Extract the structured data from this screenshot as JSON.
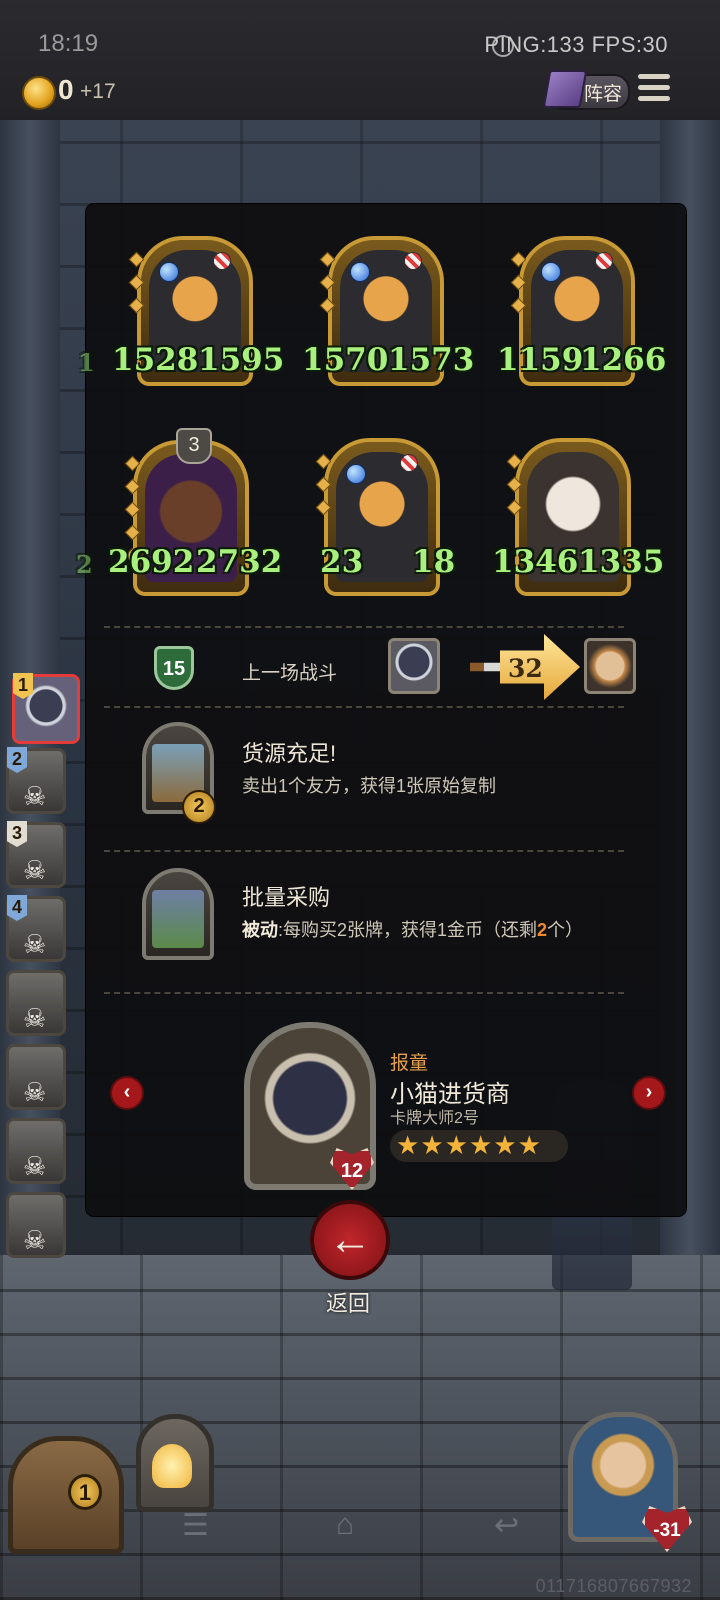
{
  "status_bar": {
    "time": "18:19",
    "ping_fps": "PING:133  FPS:30"
  },
  "top_bar": {
    "gold": "0",
    "gold_income": "+17",
    "lineup_label": "阵容"
  },
  "board": {
    "cards": [
      {
        "attack": "1528",
        "health": "1595",
        "art": "raccoon"
      },
      {
        "attack": "1570",
        "health": "1573",
        "art": "raccoon"
      },
      {
        "attack": "1159",
        "health": "1266",
        "art": "raccoon"
      },
      {
        "attack": "2692",
        "health": "2732",
        "art": "rat",
        "tier": "3"
      },
      {
        "attack": "23",
        "health": "18",
        "art": "raccoon"
      },
      {
        "attack": "1346",
        "health": "1335",
        "art": "mask"
      }
    ]
  },
  "last_battle": {
    "level": "15",
    "label": "上一场战斗",
    "damage": "32"
  },
  "abilities": [
    {
      "title": "货源充足!",
      "desc": "卖出1个友方，获得1张原始复制",
      "count": "2"
    },
    {
      "title": "批量采购",
      "desc_prefix": "被动",
      "desc_main": ":每购买2张牌，获得1金币（还剩",
      "desc_count": "2",
      "desc_suffix": "个）"
    }
  ],
  "hero": {
    "tag": "报童",
    "name": "小猫进货商",
    "subtitle": "卡牌大师2号",
    "health": "12",
    "stars": [
      "★",
      "★",
      "★",
      "★",
      "★",
      "★"
    ]
  },
  "return_label": "返回",
  "roster": [
    "1",
    "2",
    "3",
    "4"
  ],
  "bottom": {
    "refresh_count": "1",
    "opponent_health": "-31",
    "build_id": "011716807667932"
  },
  "colors": {
    "stat_green": "#a9f07f",
    "accent_red": "#a4171b",
    "gold": "#efc350"
  }
}
